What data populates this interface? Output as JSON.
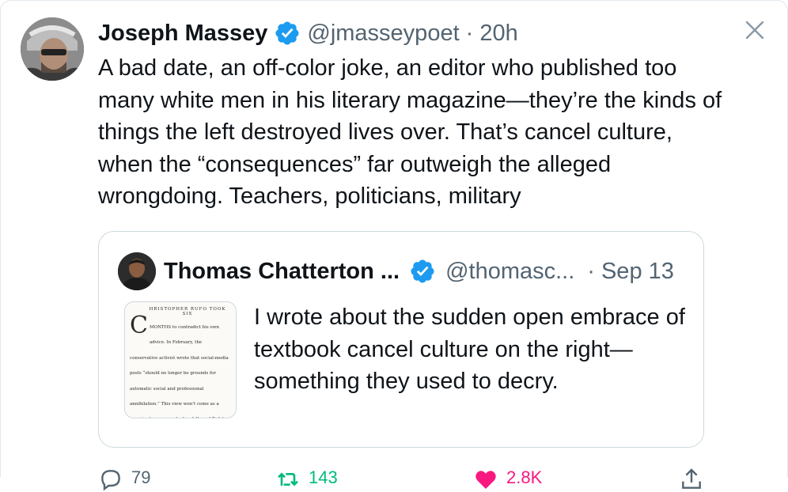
{
  "tweet": {
    "author_name": "Joseph Massey",
    "handle": "@jmasseypoet",
    "separator": "·",
    "time": "20h",
    "text": "A bad date, an off-color joke, an editor who published too many white men in his literary magazine—they’re the kinds of things the left destroyed lives over. That’s cancel culture, when the “consequences” far outweigh the alleged wrongdoing. Teachers, politicians, military"
  },
  "quoted_tweet": {
    "author_name": "Thomas Chatterton ...",
    "handle": "@thomasc...",
    "separator": "·",
    "time": "Sep 13",
    "text": "I wrote about the sudden open embrace of textbook cancel culture on the right—something they used to decry.",
    "thumbnail": {
      "heading": "HRISTOPHER RUFO TOOK SIX",
      "dropcap": "C",
      "body": "MONTHS to contradict his own advice. In February, the conservative activist wrote that social-media posts “should no longer be grounds for automatic social and professional annihilation.” This view won’t come as a surprise to anyone who has followed Rufo’s long crusade against left-wing cancel culture. By August, however, he had emulated his enemies, arousing outrage over a journalist’s old tweets. The episode demonstrates not just his own hypocrisy but also why campaigns"
    }
  },
  "actions": {
    "reply_count": "79",
    "retweet_count": "143",
    "like_count": "2.8K"
  },
  "colors": {
    "verified_blue": "#1d9bf0",
    "secondary_text": "#536471",
    "border": "#cfd9de",
    "retweet_green": "#00ba7c",
    "like_pink": "#f91880"
  },
  "icons": [
    "verified-badge-icon",
    "close-icon",
    "reply-icon",
    "retweet-icon",
    "like-icon",
    "share-icon"
  ]
}
